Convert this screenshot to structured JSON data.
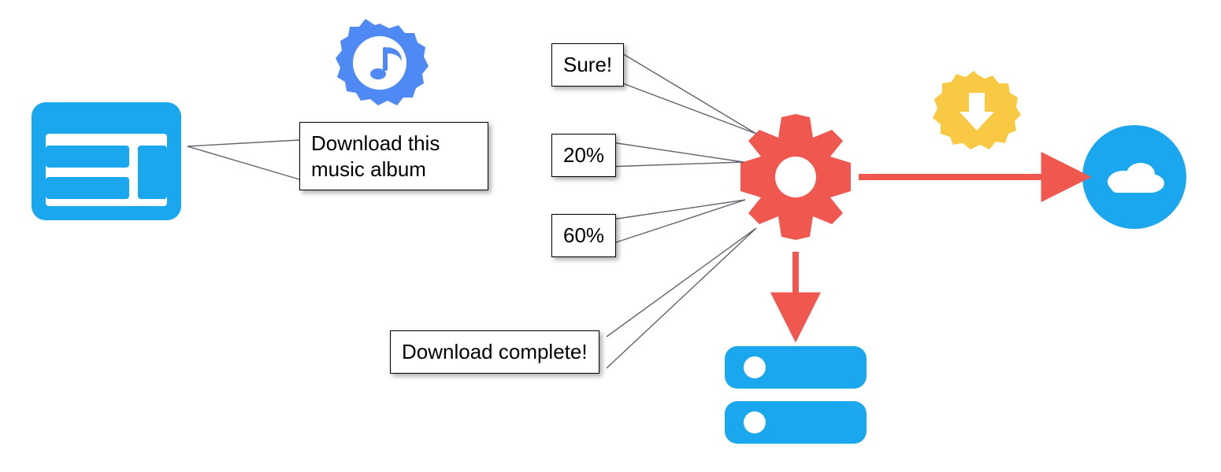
{
  "colors": {
    "blue": "#1aa7ee",
    "blue_badge": "#4f89f4",
    "red": "#f0574e",
    "yellow": "#f9c943",
    "white": "#ffffff",
    "black": "#000000",
    "gray_leader": "#60646c"
  },
  "labels": {
    "request": "Download this\nmusic album",
    "reply": "Sure!",
    "progress_a": "20%",
    "progress_b": "60%",
    "done": "Download complete!"
  },
  "icons": {
    "music_badge": "music-note-badge",
    "download_badge": "download-badge",
    "gear": "gear",
    "cloud": "cloud",
    "storage": "storage-servers",
    "client": "app-window"
  }
}
